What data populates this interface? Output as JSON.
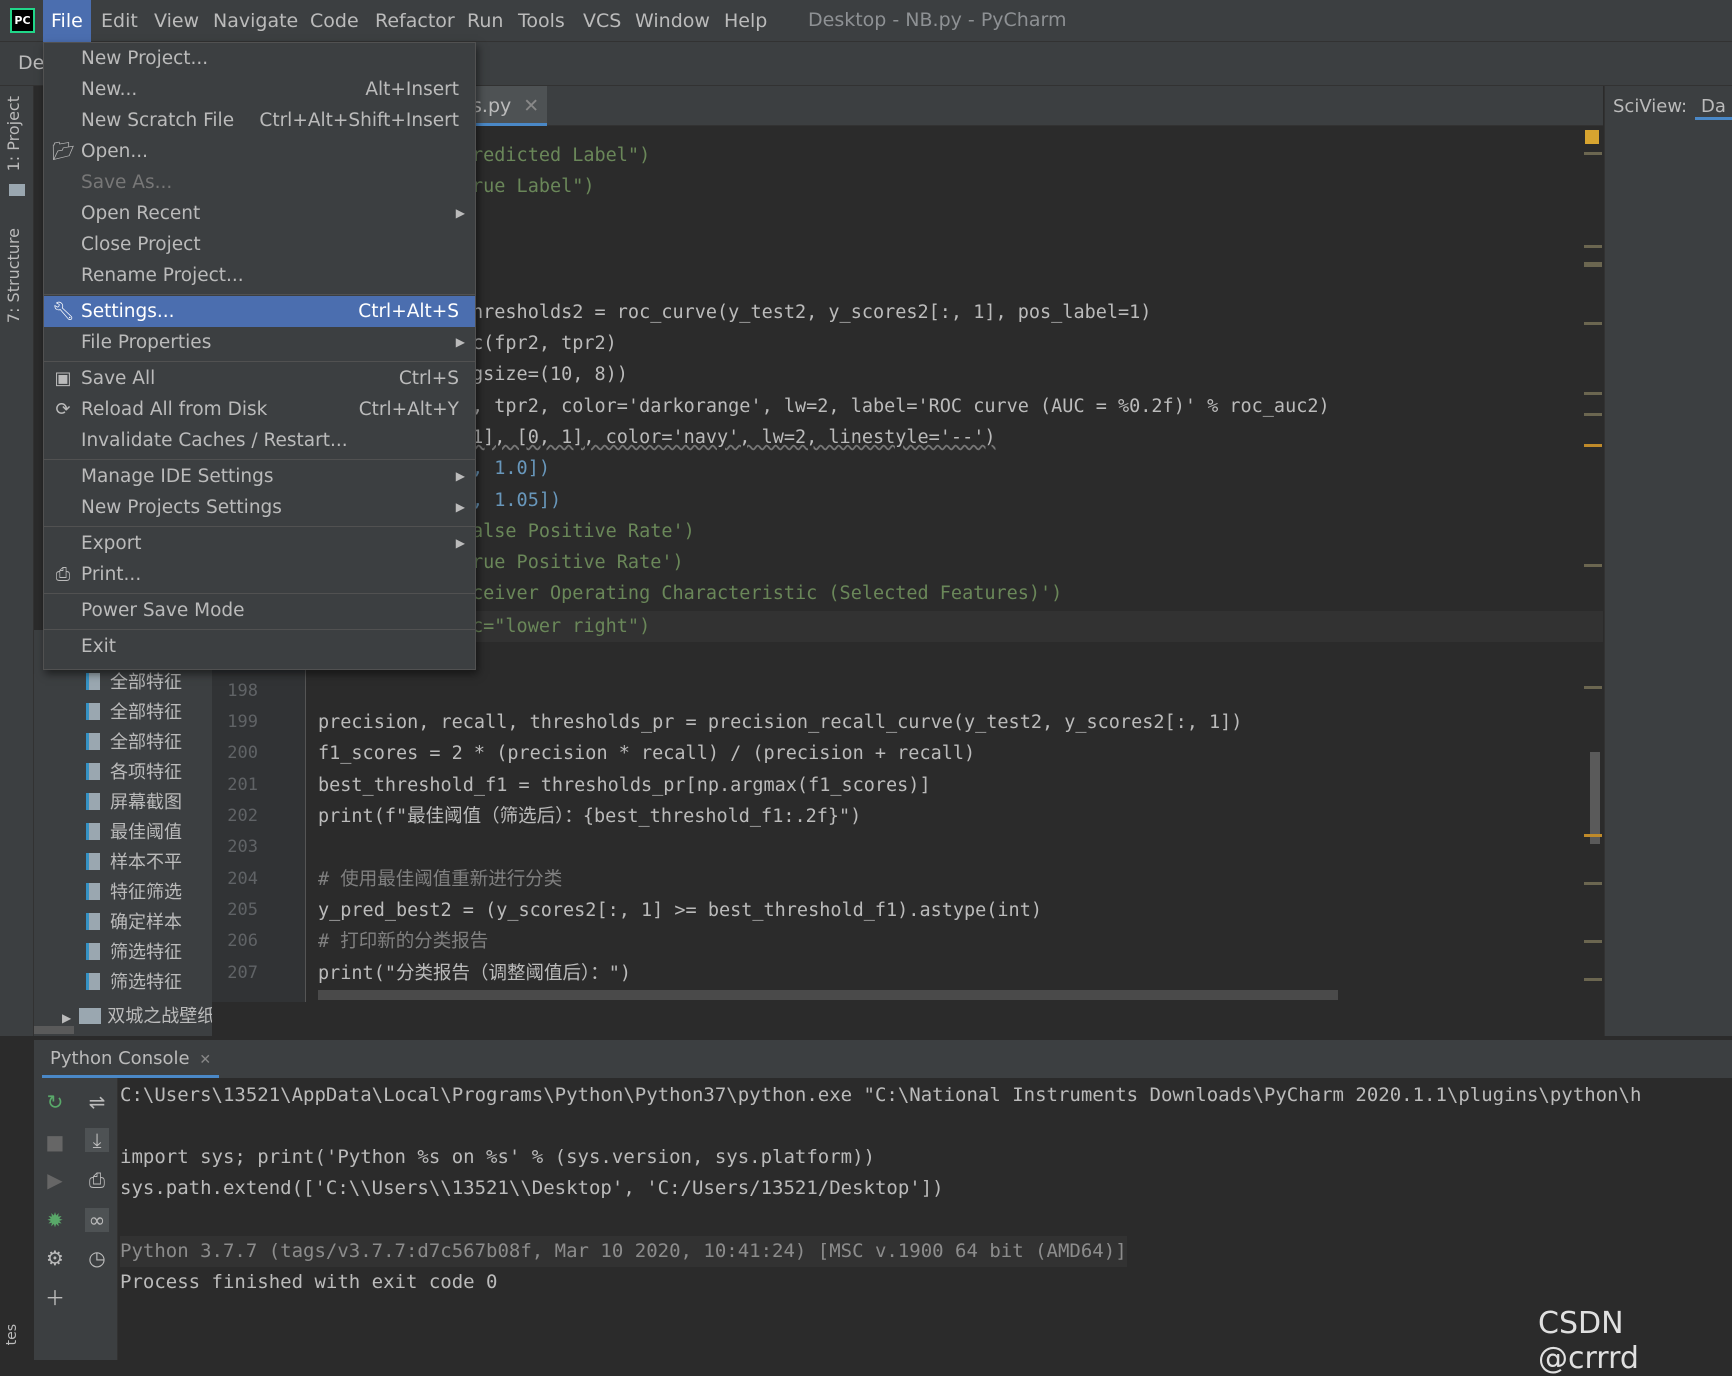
{
  "window_title": "Desktop - NB.py - PyCharm",
  "logo_text": "PC",
  "menubar": [
    "File",
    "Edit",
    "View",
    "Navigate",
    "Code",
    "Refactor",
    "Run",
    "Tools",
    "VCS",
    "Window",
    "Help"
  ],
  "toolbar_crumb": "De",
  "left_tabs": {
    "project": "1: Project",
    "structure": "7: Structure",
    "bottom": "tes"
  },
  "editor_tab": "s.py",
  "sciview": {
    "label": "SciView:",
    "tab": "Da"
  },
  "file_menu": [
    {
      "label": "New Project...",
      "shortcut": ""
    },
    {
      "label": "New...",
      "shortcut": "Alt+Insert"
    },
    {
      "label": "New Scratch File",
      "shortcut": "Ctrl+Alt+Shift+Insert"
    },
    {
      "label": "Open...",
      "shortcut": ""
    },
    {
      "label": "Save As...",
      "shortcut": ""
    },
    {
      "label": "Open Recent",
      "shortcut": ""
    },
    {
      "label": "Close Project",
      "shortcut": ""
    },
    {
      "label": "Rename Project...",
      "shortcut": ""
    },
    {
      "label": "Settings...",
      "shortcut": "Ctrl+Alt+S"
    },
    {
      "label": "File Properties",
      "shortcut": ""
    },
    {
      "label": "Save All",
      "shortcut": "Ctrl+S"
    },
    {
      "label": "Reload All from Disk",
      "shortcut": "Ctrl+Alt+Y"
    },
    {
      "label": "Invalidate Caches / Restart...",
      "shortcut": ""
    },
    {
      "label": "Manage IDE Settings",
      "shortcut": ""
    },
    {
      "label": "New Projects Settings",
      "shortcut": ""
    },
    {
      "label": "Export",
      "shortcut": ""
    },
    {
      "label": "Print...",
      "shortcut": ""
    },
    {
      "label": "Power Save Mode",
      "shortcut": ""
    },
    {
      "label": "Exit",
      "shortcut": ""
    }
  ],
  "project_files": [
    "全部特征",
    "全部特征",
    "全部特征",
    "各项特征",
    "屏幕截图",
    "最佳阈值",
    "样本不平",
    "特征筛选",
    "确定样本",
    "筛选特征",
    "筛选特征"
  ],
  "project_folder": "双城之战壁纸",
  "code_fragments": [
    "redicted Label\")",
    "rue Label\")",
    "hresholds2 = roc_curve(y_test2, y_scores2[:, 1], pos_label=1)",
    "c(fpr2, tpr2)",
    "gsize=(10, 8))",
    ", tpr2, color='darkorange', lw=2, label='ROC curve (AUC = %0.2f)' % roc_auc2)",
    "1], [0, 1], color='navy', lw=2, linestyle='--')",
    ", 1.0])",
    ", 1.05])",
    "alse Positive Rate')",
    "rue Positive Rate')",
    "ceiver Operating Characteristic (Selected Features)')",
    "c=\"lower right\")"
  ],
  "line_numbers": [
    "198",
    "199",
    "200",
    "201",
    "202",
    "203",
    "204",
    "205",
    "206",
    "207"
  ],
  "code_lines": [
    "",
    "precision, recall, thresholds_pr = precision_recall_curve(y_test2, y_scores2[:, 1])",
    "f1_scores = 2 * (precision * recall) / (precision + recall)",
    "best_threshold_f1 = thresholds_pr[np.argmax(f1_scores)]",
    "print(f\"最佳阈值（筛选后）：{best_threshold_f1:.2f}\")",
    "",
    "# 使用最佳阈值重新进行分类",
    "y_pred_best2 = (y_scores2[:, 1] >= best_threshold_f1).astype(int)",
    "# 打印新的分类报告",
    "print(\"分类报告（调整阈值后）：\")"
  ],
  "console": {
    "tab": "Python Console",
    "lines": [
      "C:\\Users\\13521\\AppData\\Local\\Programs\\Python\\Python37\\python.exe \"C:\\National Instruments Downloads\\PyCharm 2020.1.1\\plugins\\python\\h",
      "",
      "import sys; print('Python %s on %s' % (sys.version, sys.platform))",
      "sys.path.extend(['C:\\\\Users\\\\13521\\\\Desktop', 'C:/Users/13521/Desktop'])",
      "",
      "Python 3.7.7 (tags/v3.7.7:d7c567b08f, Mar 10 2020, 10:41:24) [MSC v.1900 64 bit (AMD64)]",
      "Process finished with exit code 0"
    ]
  },
  "watermark": "CSDN @crrrd",
  "colors": {
    "selection": "#4b6eaf",
    "background": "#2b2b2b",
    "panel": "#3c3f41",
    "keyword": "#cc7832",
    "string": "#6a8759",
    "number": "#6897bb"
  }
}
